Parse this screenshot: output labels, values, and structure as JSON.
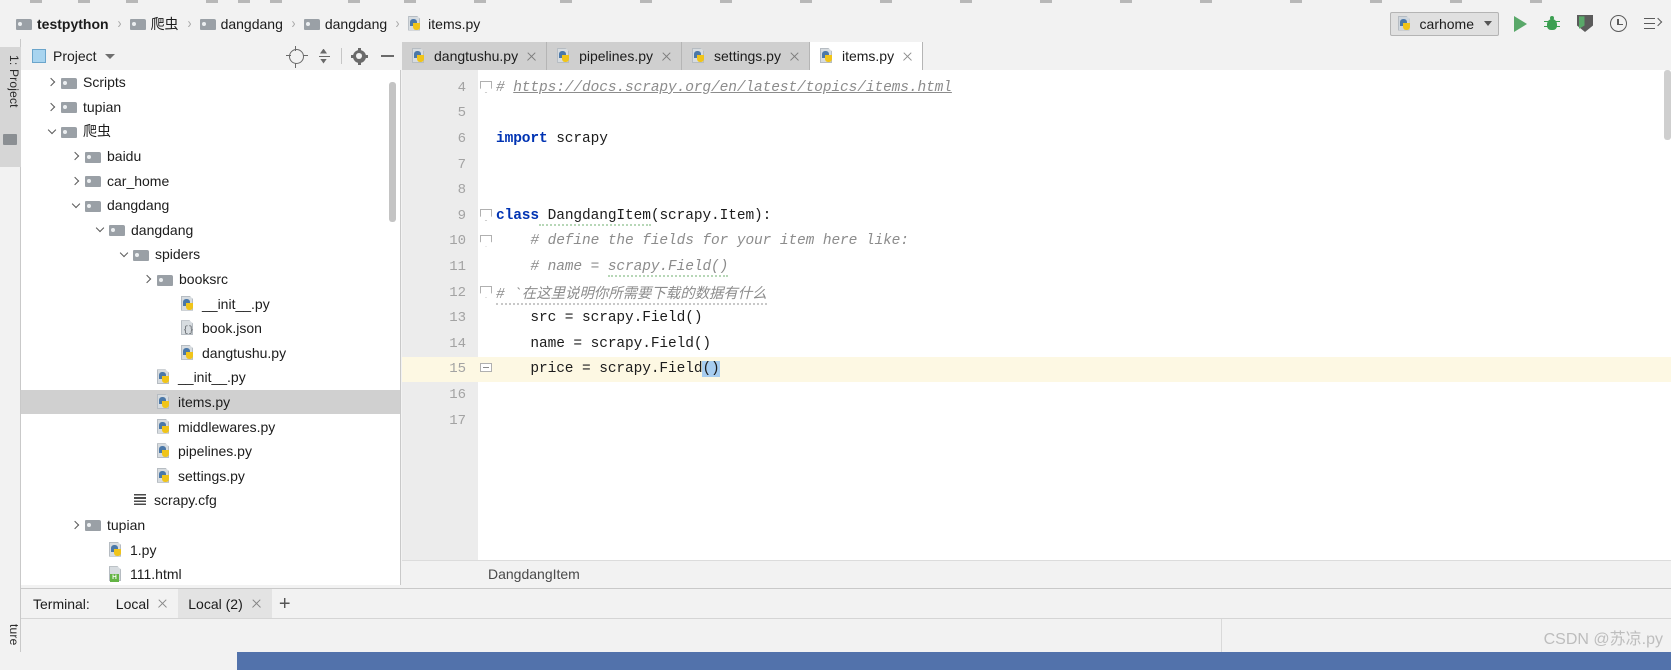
{
  "window": {
    "breadcrumb": [
      {
        "label": "testpython",
        "icon": "folder-icon",
        "root": true
      },
      {
        "label": "爬虫",
        "icon": "folder-icon",
        "root": false
      },
      {
        "label": "dangdang",
        "icon": "folder-icon",
        "root": false
      },
      {
        "label": "dangdang",
        "icon": "folder-icon",
        "root": false
      },
      {
        "label": "items.py",
        "icon": "python-file-icon",
        "root": false
      }
    ],
    "separator": "›"
  },
  "run_toolbar": {
    "config_name": "carhome",
    "config_icon": "python-icon",
    "dropdown_icon": "chevron-down-icon",
    "run_icon": "run-play-icon",
    "debug_icon": "debug-bug-icon",
    "coverage_icon": "run-with-coverage-icon",
    "profile_icon": "profiler-icon",
    "more_icon": "more-run-options-icon"
  },
  "left_tool_strip": {
    "project_tab": "1: Project",
    "structure_tab": "ture"
  },
  "project_panel": {
    "title": "Project",
    "title_icon": "project-view-icon",
    "dropdown_icon": "chevron-down-icon",
    "buttons": [
      {
        "name": "locate-target-icon"
      },
      {
        "name": "collapse-all-icon"
      },
      {
        "name": "settings-gear-icon"
      },
      {
        "name": "hide-panel-icon"
      }
    ],
    "tree": [
      {
        "label": "Scripts",
        "indent": 1,
        "arrow": "right",
        "icon": "folder-icon",
        "selected": false
      },
      {
        "label": "tupian",
        "indent": 1,
        "arrow": "right",
        "icon": "folder-icon",
        "selected": false
      },
      {
        "label": "爬虫",
        "indent": 1,
        "arrow": "down",
        "icon": "folder-icon",
        "selected": false
      },
      {
        "label": "baidu",
        "indent": 2,
        "arrow": "right",
        "icon": "folder-icon",
        "selected": false
      },
      {
        "label": "car_home",
        "indent": 2,
        "arrow": "right",
        "icon": "folder-icon",
        "selected": false
      },
      {
        "label": "dangdang",
        "indent": 2,
        "arrow": "down",
        "icon": "folder-icon",
        "selected": false
      },
      {
        "label": "dangdang",
        "indent": 3,
        "arrow": "down",
        "icon": "folder-icon",
        "selected": false
      },
      {
        "label": "spiders",
        "indent": 4,
        "arrow": "down",
        "icon": "folder-icon",
        "selected": false
      },
      {
        "label": "booksrc",
        "indent": 5,
        "arrow": "right",
        "icon": "folder-icon",
        "selected": false
      },
      {
        "label": "__init__.py",
        "indent": 6,
        "arrow": "none",
        "icon": "python-file-icon",
        "selected": false
      },
      {
        "label": "book.json",
        "indent": 6,
        "arrow": "none",
        "icon": "json-file-icon",
        "selected": false
      },
      {
        "label": "dangtushu.py",
        "indent": 6,
        "arrow": "none",
        "icon": "python-file-icon",
        "selected": false
      },
      {
        "label": "__init__.py",
        "indent": 5,
        "arrow": "none",
        "icon": "python-file-icon",
        "selected": false
      },
      {
        "label": "items.py",
        "indent": 5,
        "arrow": "none",
        "icon": "python-file-icon",
        "selected": true
      },
      {
        "label": "middlewares.py",
        "indent": 5,
        "arrow": "none",
        "icon": "python-file-icon",
        "selected": false
      },
      {
        "label": "pipelines.py",
        "indent": 5,
        "arrow": "none",
        "icon": "python-file-icon",
        "selected": false
      },
      {
        "label": "settings.py",
        "indent": 5,
        "arrow": "none",
        "icon": "python-file-icon",
        "selected": false
      },
      {
        "label": "scrapy.cfg",
        "indent": 4,
        "arrow": "none",
        "icon": "cfg-file-icon",
        "selected": false
      },
      {
        "label": "tupian",
        "indent": 2,
        "arrow": "right",
        "icon": "folder-icon",
        "selected": false
      },
      {
        "label": "1.py",
        "indent": 3,
        "arrow": "none",
        "icon": "python-file-icon",
        "selected": false
      },
      {
        "label": "111.html",
        "indent": 3,
        "arrow": "none",
        "icon": "html-file-icon",
        "selected": false
      }
    ]
  },
  "editor_tabs": [
    {
      "label": "dangtushu.py",
      "icon": "python-file-icon",
      "active": false,
      "close_icon": "close-icon"
    },
    {
      "label": "pipelines.py",
      "icon": "python-file-icon",
      "active": false,
      "close_icon": "close-icon"
    },
    {
      "label": "settings.py",
      "icon": "python-file-icon",
      "active": false,
      "close_icon": "close-icon"
    },
    {
      "label": "items.py",
      "icon": "python-file-icon",
      "active": true,
      "close_icon": "close-icon"
    }
  ],
  "editor": {
    "filename": "items.py",
    "status_breadcrumb": "DangdangItem",
    "highlighted_line": 15,
    "selection": "()",
    "lines": [
      {
        "num": "4",
        "segments": [
          {
            "t": "# ",
            "c": "com"
          },
          {
            "t": "https://docs.scrapy.org/en/latest/topics/items.html",
            "c": "link"
          }
        ],
        "fold": "tri"
      },
      {
        "num": "5",
        "segments": [],
        "fold": ""
      },
      {
        "num": "6",
        "segments": [
          {
            "t": "import",
            "c": "kw"
          },
          {
            "t": " scrapy",
            "c": "plain"
          }
        ],
        "fold": ""
      },
      {
        "num": "7",
        "segments": [],
        "fold": ""
      },
      {
        "num": "8",
        "segments": [],
        "fold": ""
      },
      {
        "num": "9",
        "segments": [
          {
            "t": "class",
            "c": "kw"
          },
          {
            "t": " DangdangItem",
            "c": "squig"
          },
          {
            "t": "(scrapy.Item):",
            "c": "plain"
          }
        ],
        "fold": "tri"
      },
      {
        "num": "10",
        "segments": [
          {
            "t": "    # define the fields for your item here like:",
            "c": "com"
          }
        ],
        "fold": "tri"
      },
      {
        "num": "11",
        "segments": [
          {
            "t": "    # name = ",
            "c": "com"
          },
          {
            "t": "scrapy.Field()",
            "c": "com-squig"
          }
        ],
        "fold": ""
      },
      {
        "num": "12",
        "segments": [
          {
            "t": "# `在这里说明你所需要下载的数据有什么",
            "c": "com-squig-gray"
          }
        ],
        "fold": "tri"
      },
      {
        "num": "13",
        "segments": [
          {
            "t": "    src = scrapy.Field()",
            "c": "plain"
          }
        ],
        "fold": ""
      },
      {
        "num": "14",
        "segments": [
          {
            "t": "    name = scrapy.Field()",
            "c": "plain"
          }
        ],
        "fold": ""
      },
      {
        "num": "15",
        "segments": [
          {
            "t": "    price = scrapy.Field",
            "c": "plain"
          },
          {
            "t": "()",
            "c": "sel"
          }
        ],
        "fold": "box"
      },
      {
        "num": "16",
        "segments": [],
        "fold": ""
      },
      {
        "num": "17",
        "segments": [],
        "fold": ""
      }
    ]
  },
  "terminal": {
    "label": "Terminal:",
    "tabs": [
      {
        "label": "Local",
        "active": false,
        "close_icon": "close-icon"
      },
      {
        "label": "Local (2)",
        "active": true,
        "close_icon": "close-icon"
      }
    ],
    "add_icon": "+"
  },
  "watermark": "CSDN @苏凉.py"
}
